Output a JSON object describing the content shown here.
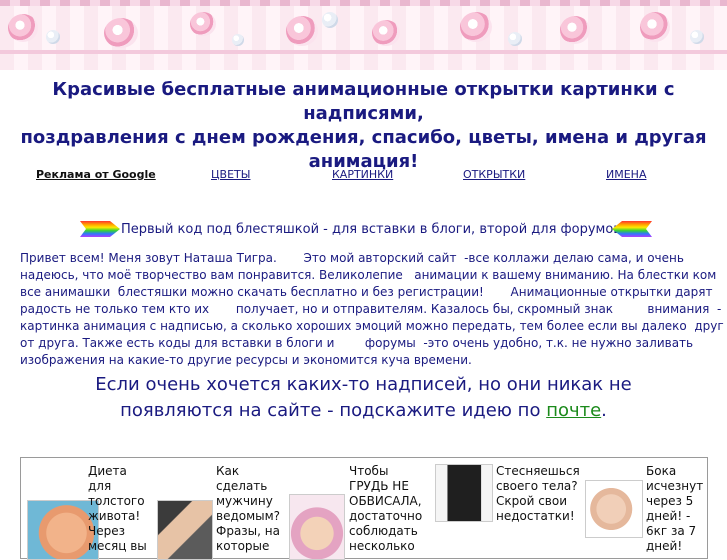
{
  "headline": {
    "line1": "Красивые бесплатные анимационные открытки картинки с надписями,",
    "line2": "поздравления с днем рождения, спасибо, цветы, имена и другая",
    "line3": "анимация!"
  },
  "nav": {
    "ad_label": "Реклама от Google",
    "links": [
      "ЦВЕТЫ",
      "КАРТИНКИ",
      "ОТКРЫТКИ",
      "ИМЕНА"
    ]
  },
  "glitter_line": "Первый код под блестяшкой - для вставки в блоги, второй для форумов.",
  "intro": {
    "line1": "Привет всем! Меня зовут Наташа Тигра.       Это мой авторский сайт  -все коллажи делаю сама, и очень",
    "line2": "надеюсь, что моё творчество вам понравится. Великолепие   анимации к вашему вниманию. На блестки ком",
    "line3": "все анимашки  блестяшки можно скачать бесплатно и без регистрации!       Анимационные открытки дарят",
    "line4": "радость не только тем кто их       получает, но и отправителям. Казалось бы, скромный знак         внимания  -",
    "line5": "картинка анимация с надписью, а сколько хороших эмоций можно передать, тем более если вы далеко  друг",
    "line6": "от друга. Также есть коды для вставки в блоги и        форумы  -это очень удобно, т.к. не нужно заливать",
    "line7": "изображения на какие-то другие ресурсы и экономится куча времени."
  },
  "callout": {
    "line1": "Если очень хочется каких-то надписей, но они никак не",
    "line2_prefix": "появляются на сайте - подскажите идею по",
    "link": "почте",
    "suffix": "."
  },
  "ads": [
    {
      "text": [
        "Диета",
        "для",
        "толстого",
        "живота!",
        "Через",
        "месяц вы"
      ]
    },
    {
      "text": [
        "Как",
        "сделать",
        "мужчину",
        "ведомым?",
        "Фразы, на",
        "которые"
      ]
    },
    {
      "text": [
        "Чтобы",
        "ГРУДЬ НЕ",
        "ОБВИСАЛА,",
        "достаточно",
        "соблюдать",
        "несколько"
      ]
    },
    {
      "text": [
        "Стесняешься",
        "своего тела?",
        "Скрой свои",
        "недостатки!"
      ]
    },
    {
      "text": [
        "Бока",
        "исчезнут",
        "через 5",
        "дней! -",
        "6кг за 7",
        "дней!"
      ]
    }
  ]
}
